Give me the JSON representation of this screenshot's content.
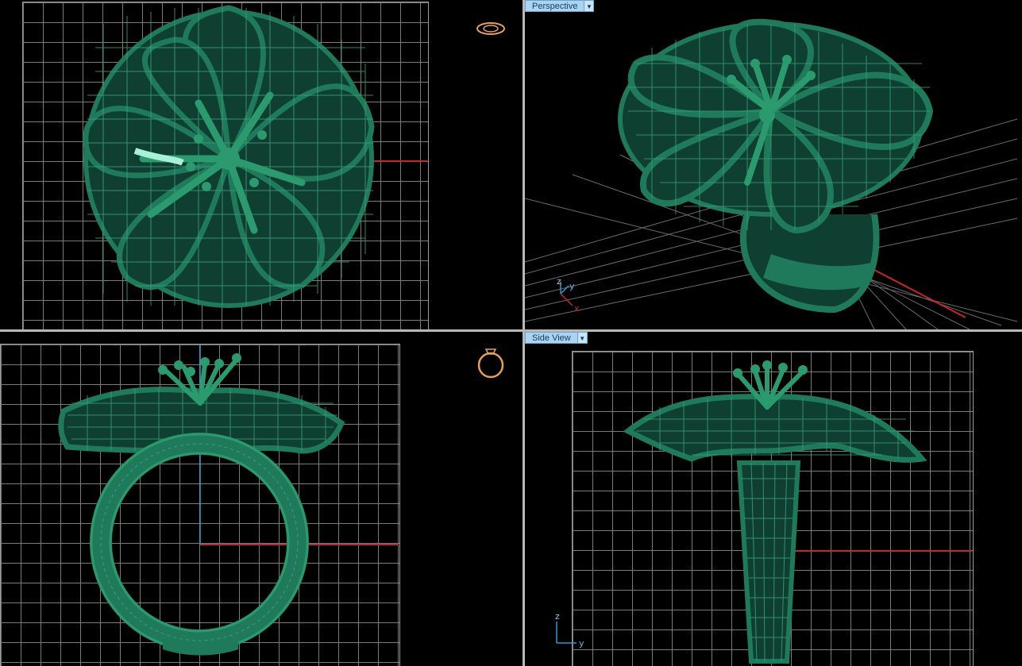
{
  "viewports": {
    "top": {
      "label": "",
      "background": "#000000"
    },
    "perspective": {
      "label": "Perspective",
      "dropdown_icon": "triangle-down"
    },
    "front": {
      "label": ""
    },
    "side": {
      "label": "Side View",
      "dropdown_icon": "triangle-down"
    }
  },
  "axes": {
    "perspective": {
      "x": "x",
      "y": "y",
      "z": "z"
    },
    "side": {
      "y": "y",
      "z": "z"
    }
  },
  "colors": {
    "model": "#1e7a5a",
    "model_dark": "#0d4a35",
    "grid": "#7a7a7a",
    "x_axis": "#c0282b",
    "y_axis": "#2a9acb",
    "label_bg": "#a9d4f2",
    "view_cube": "#e0a060"
  },
  "icons": [
    "ring-top-view-icon",
    "ring-front-view-icon",
    "dropdown-arrow-icon"
  ]
}
